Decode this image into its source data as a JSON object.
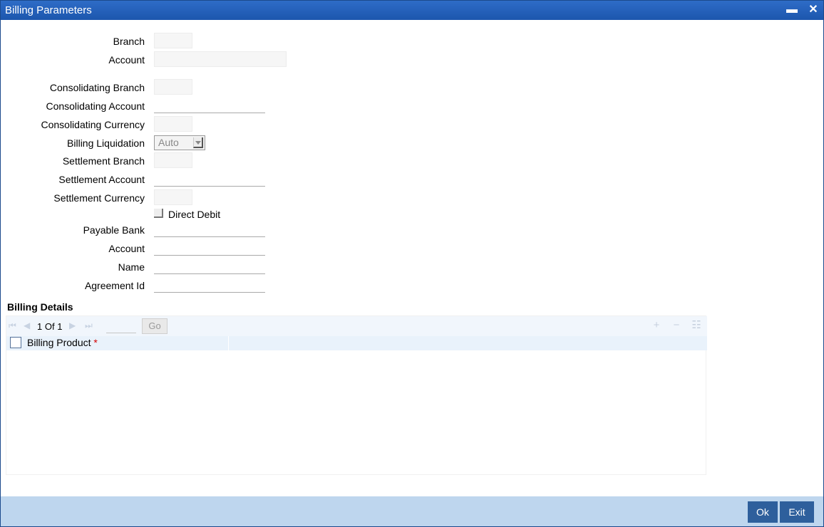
{
  "window": {
    "title": "Billing Parameters"
  },
  "titlebar": {
    "minimize_glyph": "▬",
    "close_glyph": "✕"
  },
  "form": {
    "branch_label": "Branch",
    "account_label": "Account",
    "consolidating_branch_label": "Consolidating Branch",
    "consolidating_account_label": "Consolidating Account",
    "consolidating_currency_label": "Consolidating Currency",
    "billing_liquidation_label": "Billing Liquidation",
    "billing_liquidation_value": "Auto",
    "settlement_branch_label": "Settlement Branch",
    "settlement_account_label": "Settlement Account",
    "settlement_currency_label": "Settlement Currency",
    "direct_debit_label": "Direct Debit",
    "payable_bank_label": "Payable Bank",
    "payable_account_label": "Account",
    "name_label": "Name",
    "agreement_id_label": "Agreement Id"
  },
  "billing_details": {
    "title": "Billing Details",
    "pager": {
      "current": "1",
      "of_label": "Of",
      "total": "1"
    },
    "go_label": "Go",
    "columns": [
      {
        "label": "Billing Product",
        "required_mark": "*"
      }
    ],
    "rows": []
  },
  "footer": {
    "ok_label": "Ok",
    "exit_label": "Exit"
  },
  "colors": {
    "titlebar": "#1c56ad",
    "footer": "#bed6ee",
    "button": "#2e5f9c",
    "required": "#d40000"
  },
  "icons": [
    "minimize-icon",
    "close-icon",
    "first-page-icon",
    "prev-page-icon",
    "next-page-icon",
    "last-page-icon",
    "add-row-icon",
    "delete-row-icon",
    "single-view-icon"
  ]
}
